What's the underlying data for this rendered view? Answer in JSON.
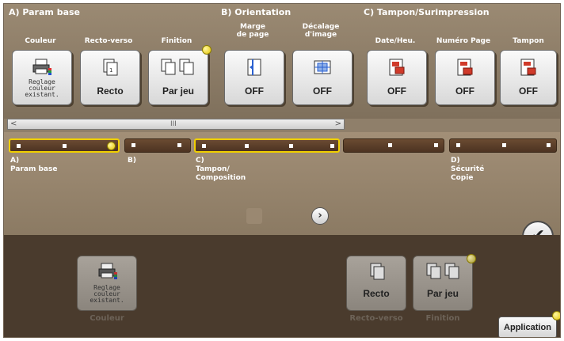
{
  "groups": {
    "a": {
      "title": "A)   Param base",
      "buttons": {
        "couleur": {
          "label": "Couleur",
          "value": "Reglage\ncouleur\nexistant."
        },
        "recto_verso": {
          "label": "Recto-verso",
          "value": "Recto"
        },
        "finition": {
          "label": "Finition",
          "value": "Par jeu"
        }
      }
    },
    "b": {
      "title": "B)   Orientation",
      "buttons": {
        "marge": {
          "label": "Marge\nde page",
          "value": "OFF"
        },
        "decalage": {
          "label": "Décalage\nd'image",
          "value": "OFF"
        }
      }
    },
    "c": {
      "title": "C)   Tampon/Surimpression",
      "buttons": {
        "date": {
          "label": "Date/Heu.",
          "value": "OFF"
        },
        "numero": {
          "label": "Numéro Page",
          "value": "OFF"
        },
        "tampon": {
          "label": "Tampon",
          "value": "OFF"
        }
      }
    }
  },
  "scrollbar": {
    "left": "<",
    "right": ">",
    "thumb": "III"
  },
  "nav": {
    "a": "A)\nParam base",
    "b": "B)",
    "c": "C)\nTampon/\nComposition",
    "d": "D)\nSécurité\nCopie"
  },
  "next_icon": "chevron-right-icon",
  "ok_icon": "checkmark-icon",
  "summary": {
    "couleur": {
      "value": "Reglage\ncouleur\nexistant.",
      "caption": "Couleur"
    },
    "recto": {
      "value": "Recto",
      "caption": "Recto-verso"
    },
    "finition": {
      "value": "Par jeu",
      "caption": "Finition"
    }
  },
  "application_label": "Application",
  "colors": {
    "indicator": "#e4c400",
    "panel": "#8f7f6a",
    "bottom": "#4a3b2d"
  }
}
